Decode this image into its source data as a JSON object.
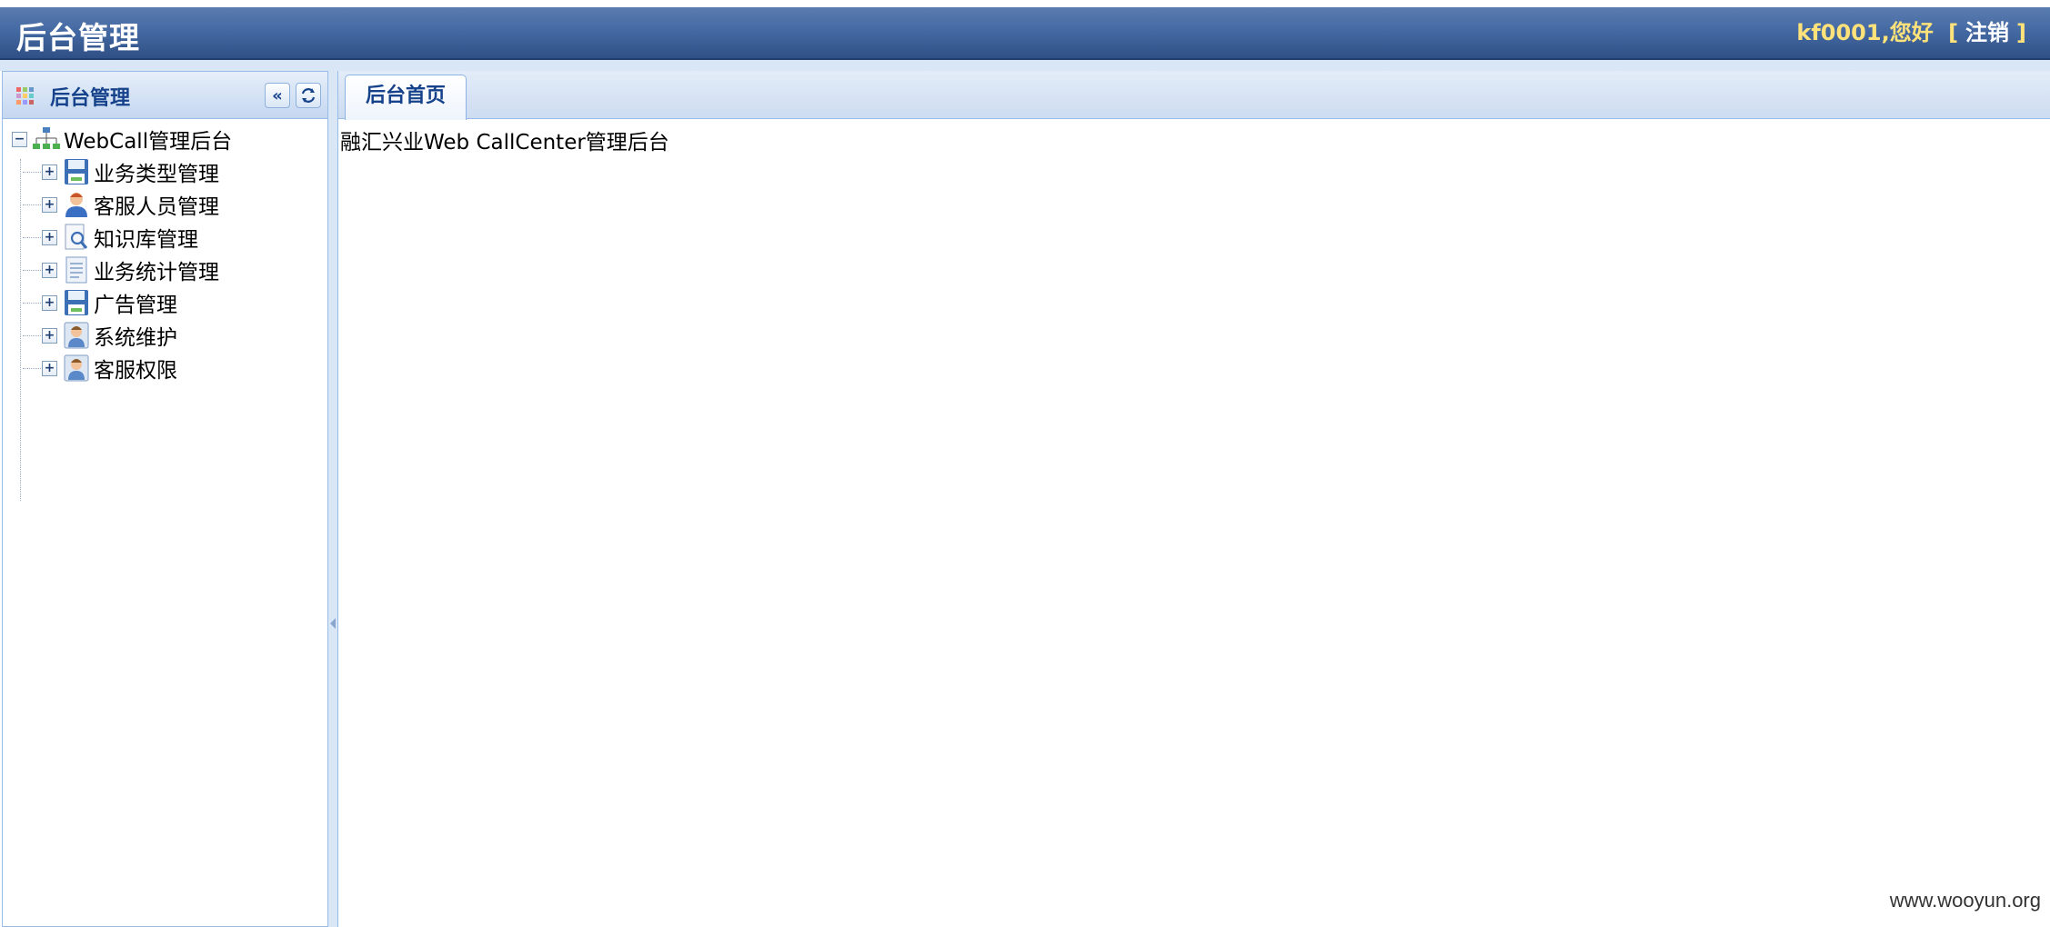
{
  "header": {
    "title": "后台管理",
    "username": "kf0001",
    "greeting": ",您好",
    "bracket_open": "[",
    "logout": "注销",
    "bracket_close": "]"
  },
  "sidebar": {
    "title": "后台管理",
    "collapse_icon": "double-chevron-left-icon",
    "refresh_icon": "refresh-icon",
    "root": {
      "label": "WebCall管理后台",
      "icon": "org-chart-icon",
      "expander": "⊟"
    },
    "items": [
      {
        "label": "业务类型管理",
        "icon": "floppy-disk-icon",
        "expander": "+"
      },
      {
        "label": "客服人员管理",
        "icon": "user-icon",
        "expander": "+"
      },
      {
        "label": "知识库管理",
        "icon": "magnifier-doc-icon",
        "expander": "+"
      },
      {
        "label": "业务统计管理",
        "icon": "document-icon",
        "expander": "+"
      },
      {
        "label": "广告管理",
        "icon": "floppy-disk-icon",
        "expander": "+"
      },
      {
        "label": "系统维护",
        "icon": "user-card-icon",
        "expander": "+"
      },
      {
        "label": "客服权限",
        "icon": "user-card-icon",
        "expander": "+"
      }
    ]
  },
  "main": {
    "tabs": [
      {
        "label": "后台首页"
      }
    ],
    "content_text": "融汇兴业Web CallCenter管理后台"
  },
  "watermark": "www.wooyun.org",
  "colors": {
    "header_bg": "#456aa3",
    "accent_text": "#15428b",
    "username": "#ffe37a",
    "panel_border": "#99bbe8"
  }
}
